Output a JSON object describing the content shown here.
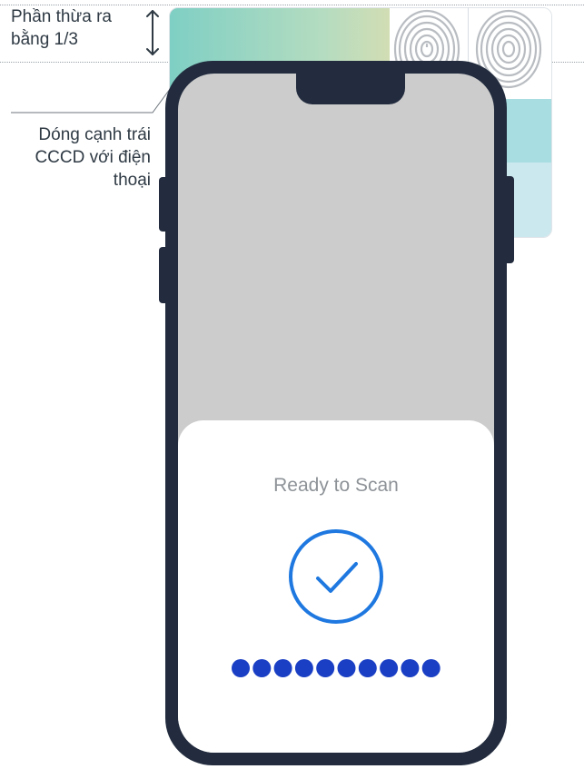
{
  "annotations": {
    "overhang_line1": "Phần thừa ra",
    "overhang_line2": "bằng 1/3",
    "align_line1": "Dóng cạnh trái",
    "align_line2": "CCCD với điện",
    "align_line3": "thoại"
  },
  "scan_sheet": {
    "title": "Ready to Scan",
    "progress_dots": 10
  },
  "colors": {
    "phone_frame": "#222c3e",
    "screen": "#cccccc",
    "check_accent": "#1e78e0",
    "dot": "#1a3fc4"
  },
  "icons": [
    "up-down-arrow-icon",
    "fingerprint-icon",
    "checkmark-circle-icon"
  ]
}
